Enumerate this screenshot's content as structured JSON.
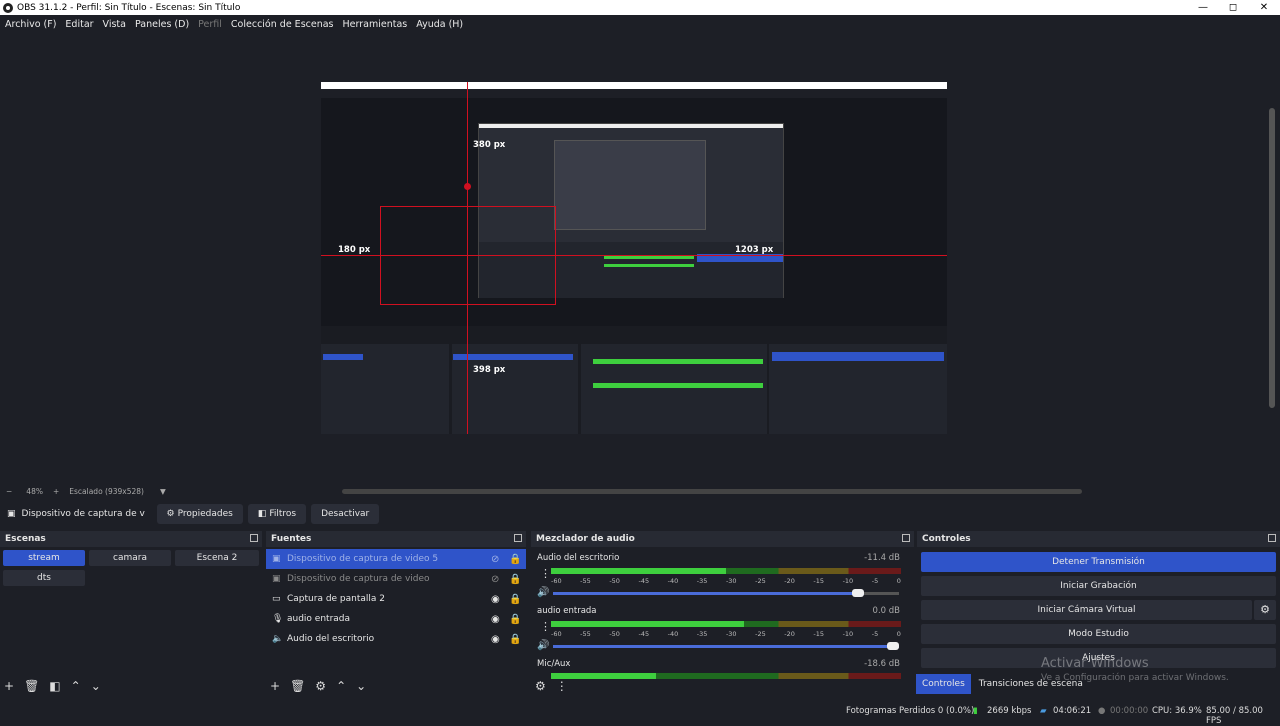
{
  "window": {
    "title": "OBS 31.1.2 - Perfil: Sin Título - Escenas: Sin Título",
    "min": "—",
    "max": "◻",
    "close": "✕"
  },
  "menu": [
    "Archivo (F)",
    "Editar",
    "Vista",
    "Paneles (D)",
    "Perfil",
    "Colección de Escenas",
    "Herramientas",
    "Ayuda (H)"
  ],
  "preview": {
    "measures": {
      "top": "380 px",
      "left": "180 px",
      "right": "1203 px",
      "bottom": "398 px"
    }
  },
  "zoom": {
    "minus": "−",
    "value": "48%",
    "plus": "+",
    "scale": "Escalado (939x528)"
  },
  "source_bar": {
    "name": "Dispositivo de captura de v",
    "properties": "Propiedades",
    "filters": "Filtros",
    "deactivate": "Desactivar"
  },
  "scenes": {
    "title": "Escenas",
    "items": [
      "stream",
      "camara",
      "Escena 2",
      "dts"
    ]
  },
  "sources": {
    "title": "Fuentes",
    "items": [
      "Dispositivo de captura de video 5",
      "Dispositivo de captura de video",
      "Captura de pantalla 2",
      "audio entrada",
      "Audio del escritorio"
    ]
  },
  "mixer": {
    "title": "Mezclador de audio",
    "channels": [
      {
        "name": "Audio del escritorio",
        "db": "-11.4 dB",
        "level": 0.5,
        "volume": 0.9
      },
      {
        "name": "audio entrada",
        "db": "0.0 dB",
        "level": 0.55,
        "volume": 1.0
      },
      {
        "name": "Mic/Aux",
        "db": "-18.6 dB",
        "level": 0.3,
        "volume": 0.9
      }
    ],
    "scale": [
      "-60",
      "-55",
      "-50",
      "-45",
      "-40",
      "-35",
      "-30",
      "-25",
      "-20",
      "-15",
      "-10",
      "-5",
      "0"
    ]
  },
  "controls": {
    "title": "Controles",
    "buttons": [
      "Detener Transmisión",
      "Iniciar Grabación",
      "Iniciar Cámara Virtual",
      "Modo Estudio",
      "Ajustes"
    ],
    "tab_controls": "Controles",
    "tab_transitions": "Transiciones de escena"
  },
  "watermark": {
    "line1": "Activar Windows",
    "line2": "Ve a Configuración para activar Windows."
  },
  "status": {
    "dropped": "Fotogramas Perdidos 0 (0.0%)",
    "bitrate": "2669 kbps",
    "stream_time": "04:06:21",
    "rec_time": "00:00:00",
    "cpu": "CPU: 36.9%",
    "fps": "85.00 / 85.00 FPS"
  },
  "colors": {
    "accent": "#2f54c9",
    "marker": "#d01020",
    "meter_green": "#3ecf3e"
  }
}
